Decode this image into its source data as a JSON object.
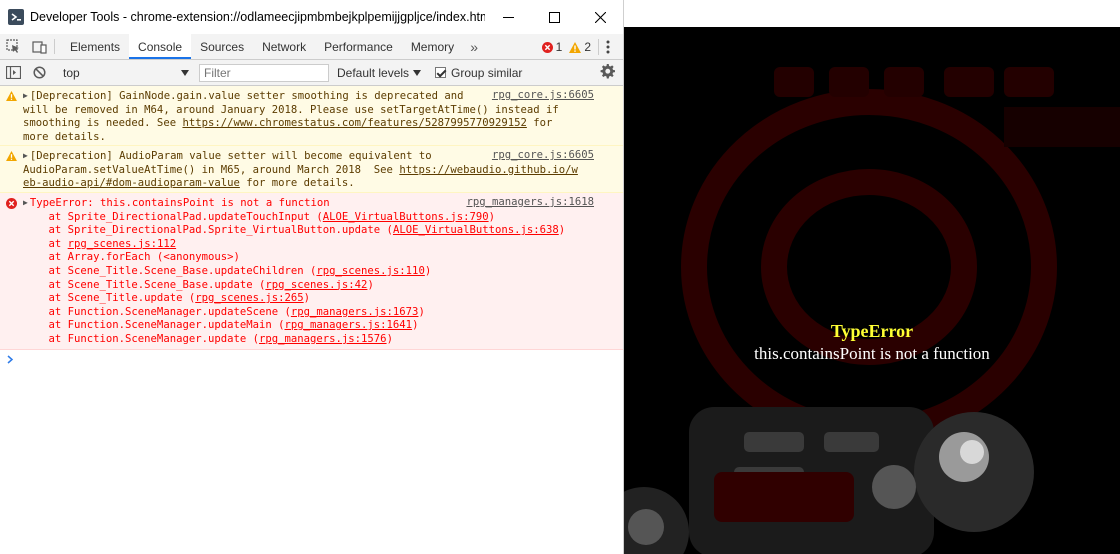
{
  "window": {
    "title": "Developer Tools - chrome-extension://odlameecjipmbmbejkplpemijjgpljce/index.html"
  },
  "tabs": [
    "Elements",
    "Console",
    "Sources",
    "Network",
    "Performance",
    "Memory"
  ],
  "active_tab": "Console",
  "counters": {
    "errors": "1",
    "warnings": "2"
  },
  "toolbar": {
    "context": "top",
    "filter_placeholder": "Filter",
    "levels": "Default levels",
    "group_similar": "Group similar"
  },
  "messages": {
    "warn1": {
      "lines": [
        "[Deprecation] GainNode.gain.value setter smoothing is deprecated and",
        "will be removed in M64, around January 2018. Please use setTargetAtTime() instead if",
        "smoothing is needed. See ",
        "more details."
      ],
      "link": "https://www.chromestatus.com/features/5287995770929152",
      "after_link": " for",
      "source": "rpg_core.js:6605"
    },
    "warn2": {
      "lines": [
        "[Deprecation] AudioParam value setter will become equivalent to",
        "AudioParam.setValueAtTime() in M65, around March 2018  See ",
        "eb-audio-api/#dom-audioparam-value",
        " for more details."
      ],
      "link": "https://webaudio.github.io/w",
      "source": "rpg_core.js:6605"
    },
    "error": {
      "head": "TypeError: this.containsPoint is not a function",
      "source": "rpg_managers.js:1618",
      "stack": [
        {
          "text": "    at Sprite_DirectionalPad.updateTouchInput (",
          "link": "ALOE_VirtualButtons.js:790",
          "tail": ")"
        },
        {
          "text": "    at Sprite_DirectionalPad.Sprite_VirtualButton.update (",
          "link": "ALOE_VirtualButtons.js:638",
          "tail": ")"
        },
        {
          "text": "    at ",
          "link": "rpg_scenes.js:112",
          "tail": ""
        },
        {
          "text": "    at Array.forEach (<anonymous>)",
          "link": "",
          "tail": ""
        },
        {
          "text": "    at Scene_Title.Scene_Base.updateChildren (",
          "link": "rpg_scenes.js:110",
          "tail": ")"
        },
        {
          "text": "    at Scene_Title.Scene_Base.update (",
          "link": "rpg_scenes.js:42",
          "tail": ")"
        },
        {
          "text": "    at Scene_Title.update (",
          "link": "rpg_scenes.js:265",
          "tail": ")"
        },
        {
          "text": "    at Function.SceneManager.updateScene (",
          "link": "rpg_managers.js:1673",
          "tail": ")"
        },
        {
          "text": "    at Function.SceneManager.updateMain (",
          "link": "rpg_managers.js:1641",
          "tail": ")"
        },
        {
          "text": "    at Function.SceneManager.update (",
          "link": "rpg_managers.js:1576",
          "tail": ")"
        }
      ]
    }
  },
  "game": {
    "error_title": "TypeError",
    "error_message": "this.containsPoint is not a function"
  },
  "colors": {
    "warn_bg": "#fffbe5",
    "error_bg": "#fff0f0",
    "error_text": "#ff0000",
    "accent": "#1a73e8",
    "game_error_title": "#ffff33"
  }
}
